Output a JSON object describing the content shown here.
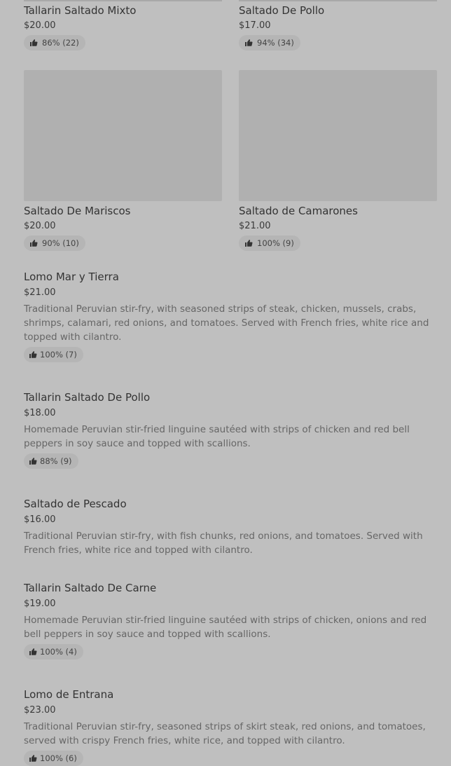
{
  "grid_items": [
    {
      "title": "Tallarin Saltado Mixto",
      "price": "$20.00",
      "rating": "86% (22)"
    },
    {
      "title": "Saltado De Pollo",
      "price": "$17.00",
      "rating": "94% (34)"
    },
    {
      "title": "Saltado De Mariscos",
      "price": "$20.00",
      "rating": "90% (10)"
    },
    {
      "title": "Saltado de Camarones",
      "price": "$21.00",
      "rating": "100% (9)"
    }
  ],
  "list_items": [
    {
      "title": "Lomo Mar y Tierra",
      "price": "$21.00",
      "description": "Traditional Peruvian stir-fry, with seasoned strips of steak, chicken, mussels, crabs, shrimps, calamari, red onions, and tomatoes. Served with French fries, white rice and topped with cilantro.",
      "rating": "100% (7)"
    },
    {
      "title": "Tallarin Saltado De Pollo",
      "price": "$18.00",
      "description": "Homemade Peruvian stir-fried linguine sautéed with strips of chicken and red bell peppers in soy sauce and topped with scallions.",
      "rating": "88% (9)"
    },
    {
      "title": "Saltado de Pescado",
      "price": "$16.00",
      "description": "Traditional Peruvian stir-fry, with fish chunks, red onions, and tomatoes. Served with French fries, white rice and topped with cilantro.",
      "rating": ""
    },
    {
      "title": "Tallarin Saltado De Carne",
      "price": "$19.00",
      "description": "Homemade Peruvian stir-fried linguine sautéed with strips of chicken, onions and red bell peppers in soy sauce and topped with scallions.",
      "rating": "100% (4)"
    },
    {
      "title": "Lomo de Entrana",
      "price": "$23.00",
      "description": "Traditional Peruvian stir-fry, seasoned strips of skirt steak, red onions, and tomatoes, served with crispy French fries, white rice, and topped with cilantro.",
      "rating": "100% (6)"
    }
  ],
  "icons": {
    "rating": "thumbs-up-icon"
  },
  "colors": {
    "background": "#bfbfbf",
    "image_placeholder": "#b0b0b0",
    "badge": "#b5b5b5"
  }
}
